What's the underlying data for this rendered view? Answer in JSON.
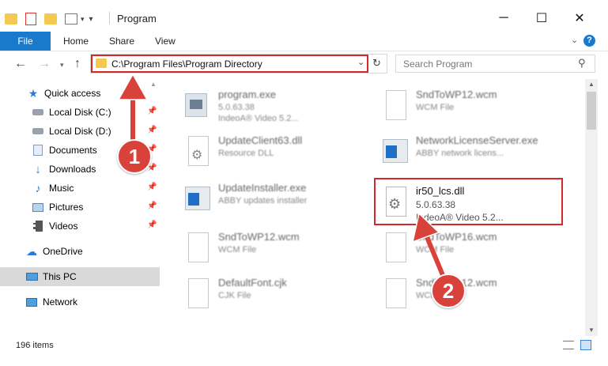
{
  "window": {
    "title": "Program",
    "minimize": "─",
    "maximize": "☐",
    "close": "✕"
  },
  "ribbon": {
    "tabs": [
      {
        "label": "File"
      },
      {
        "label": "Home"
      },
      {
        "label": "Share"
      },
      {
        "label": "View"
      }
    ],
    "help": "?"
  },
  "address": {
    "path": "C:\\Program Files\\Program Directory",
    "search_placeholder": "Search Program"
  },
  "sidebar": {
    "items": [
      {
        "label": "Quick access",
        "icon": "star-icon"
      },
      {
        "label": "Local Disk (C:)",
        "icon": "drive-icon"
      },
      {
        "label": "Local Disk (D:)",
        "icon": "drive-icon"
      },
      {
        "label": "Documents",
        "icon": "documents-icon"
      },
      {
        "label": "Downloads",
        "icon": "download-icon"
      },
      {
        "label": "Music",
        "icon": "music-icon"
      },
      {
        "label": "Pictures",
        "icon": "pictures-icon"
      },
      {
        "label": "Videos",
        "icon": "videos-icon"
      },
      {
        "label": "OneDrive",
        "icon": "cloud-icon"
      },
      {
        "label": "This PC",
        "icon": "computer-icon"
      },
      {
        "label": "Network",
        "icon": "network-icon"
      }
    ]
  },
  "files": [
    {
      "name": "program.exe",
      "line2": "5.0.63.38",
      "line3": "IndeoA® Video 5.2..."
    },
    {
      "name": "SndToWP12.wcm",
      "line2": "WCM File",
      "line3": ""
    },
    {
      "name": "UpdateClient63.dll",
      "line2": "Resource DLL",
      "line3": ""
    },
    {
      "name": "NetworkLicenseServer.exe",
      "line2": "ABBY network licens...",
      "line3": ""
    },
    {
      "name": "UpdateInstaller.exe",
      "line2": "ABBY updates installer",
      "line3": ""
    },
    {
      "name": "ir50_lcs.dll",
      "line2": "5.0.63.38",
      "line3": "IndeoA® Video 5.2..."
    },
    {
      "name": "SndToWP12.wcm",
      "line2": "WCM File",
      "line3": ""
    },
    {
      "name": "SndToWP16.wcm",
      "line2": "WCM File",
      "line3": ""
    },
    {
      "name": "DefaultFont.cjk",
      "line2": "CJK File",
      "line3": ""
    },
    {
      "name": "SndToWP12.wcm",
      "line2": "WCM File",
      "line3": ""
    }
  ],
  "status": {
    "count": "196 items"
  },
  "callouts": {
    "one": "1",
    "two": "2"
  },
  "colors": {
    "accent": "#1979ca",
    "highlight": "#d6282b",
    "callout": "#d9413b"
  }
}
